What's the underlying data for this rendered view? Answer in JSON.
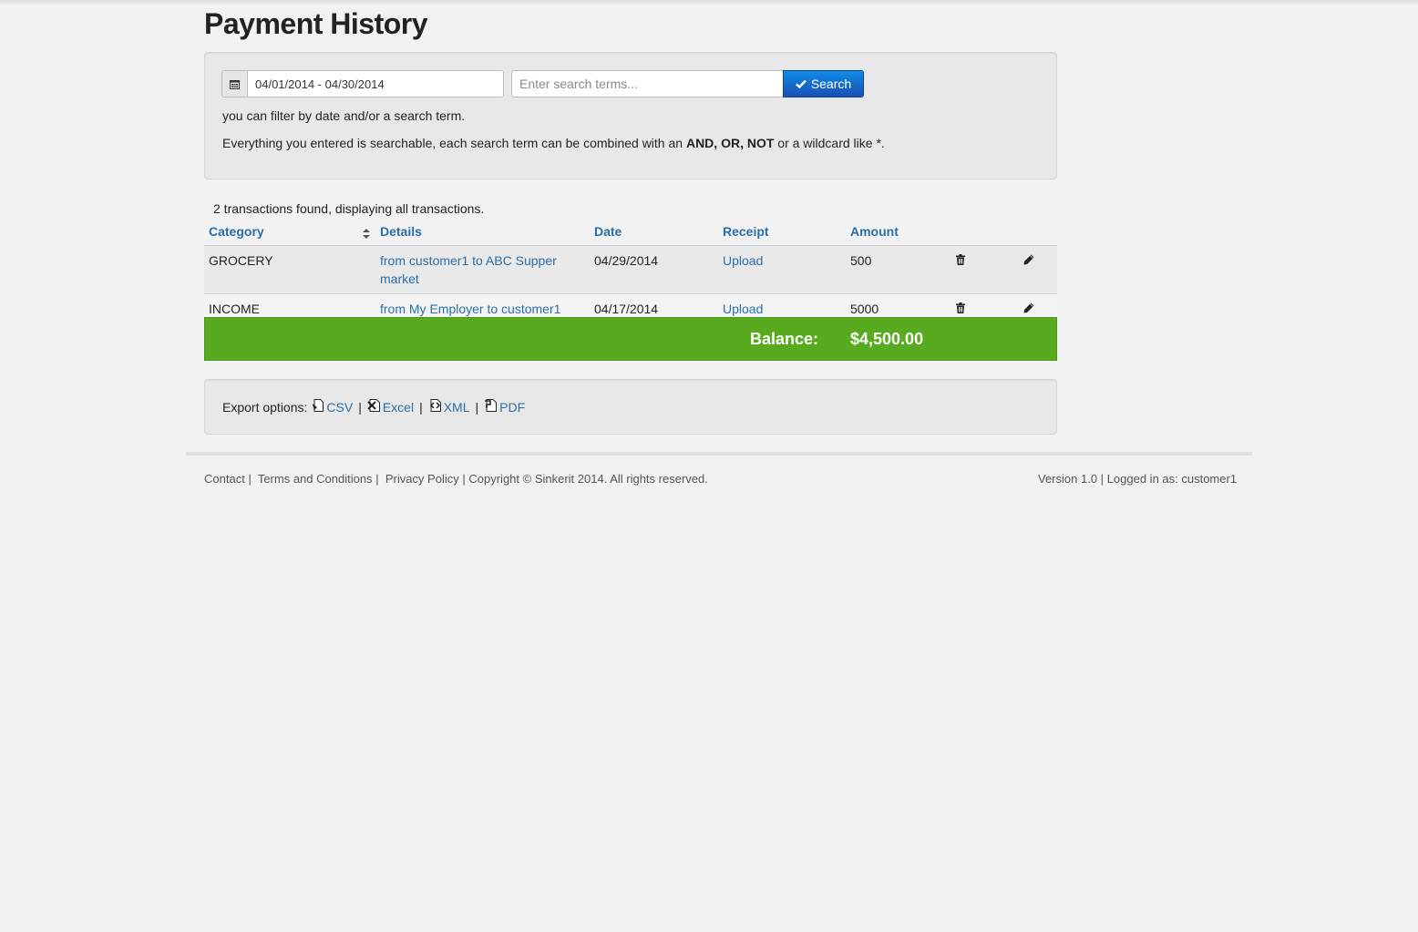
{
  "page": {
    "title": "Payment History"
  },
  "filter": {
    "date_range_value": "04/01/2014 - 04/30/2014",
    "search_placeholder": "Enter search terms...",
    "search_button_label": "Search",
    "help_line_1": "you can filter by date and/or a search term.",
    "help_line_2_prefix": "Everything you entered is searchable, each search term can be combined with an ",
    "help_line_2_bold": "AND, OR, NOT",
    "help_line_2_suffix": " or a wildcard like *."
  },
  "results": {
    "summary": "2 transactions found, displaying all transactions.",
    "columns": [
      "Category",
      "Details",
      "Date",
      "Receipt",
      "Amount"
    ],
    "rows": [
      {
        "category": "GROCERY",
        "details": "from customer1 to ABC Supper market",
        "date": "04/29/2014",
        "receipt": "Upload",
        "amount": "500"
      },
      {
        "category": "INCOME",
        "details": "from My Employer to customer1",
        "date": "04/17/2014",
        "receipt": "Upload",
        "amount": "5000"
      }
    ],
    "balance_label": "Balance:",
    "balance_value": "$4,500.00",
    "icons": {
      "delete": "trash-icon",
      "edit": "pencil-icon",
      "sort": "sort-icon"
    }
  },
  "export": {
    "label": "Export options:",
    "options": [
      {
        "label": "CSV",
        "icon": "csv-file-icon"
      },
      {
        "label": "Excel",
        "icon": "excel-file-icon"
      },
      {
        "label": "XML",
        "icon": "xml-file-icon"
      },
      {
        "label": "PDF",
        "icon": "pdf-file-icon"
      }
    ],
    "separator": "|"
  },
  "footer": {
    "links": [
      "Contact",
      "Terms and Conditions",
      "Privacy Policy"
    ],
    "separator": "|",
    "copyright": "Copyright © Sinkerit 2014. All rights reserved.",
    "version": "Version 1.0",
    "logged_in": "Logged in as: customer1"
  },
  "colors": {
    "link": "#2a6fa8",
    "search_button": "#1a5fc8",
    "balance_bar": "#58ab1f",
    "background": "#f2f2f2"
  }
}
